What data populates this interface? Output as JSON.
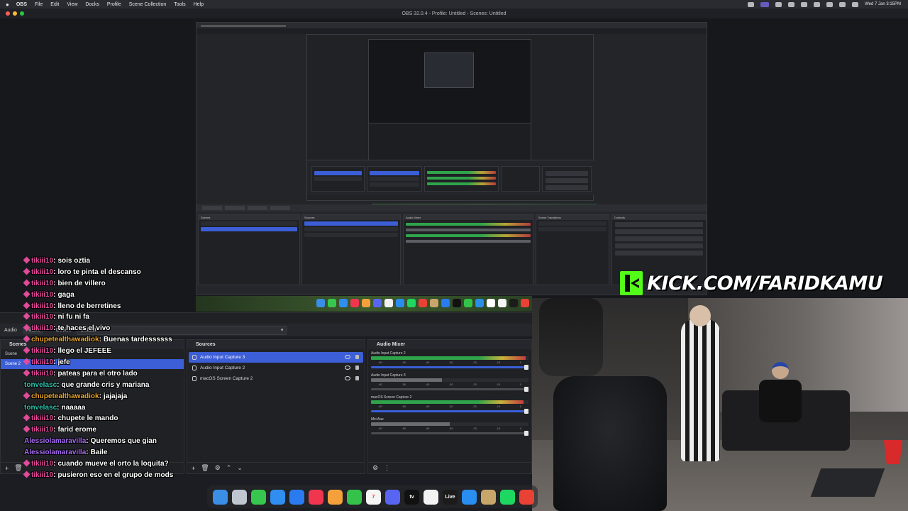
{
  "menubar": {
    "app_name": "OBS",
    "items": [
      "File",
      "Edit",
      "View",
      "Docks",
      "Profile",
      "Scene Collection",
      "Tools",
      "Help"
    ],
    "clock": "Wed 7 Jan  3:15PM"
  },
  "window": {
    "title": "OBS 32.0.4 - Profile: Untitled - Scenes: Untitled"
  },
  "kick_banner": {
    "text": "KICK.COM/FARIDKAMU",
    "color": "#53fc18"
  },
  "properties_bar": {
    "source_label": "Audio",
    "filters_tab": "Filters",
    "device_label": "Device",
    "device_value": "Default"
  },
  "scenes": {
    "title": "Scenes",
    "items": [
      "Scene",
      "Scene 2"
    ],
    "selected_index": 1
  },
  "sources": {
    "title": "Sources",
    "items": [
      {
        "name": "Audio Input Capture 3",
        "icon": "microphone-icon",
        "selected": true
      },
      {
        "name": "Audio Input Capture 2",
        "icon": "microphone-icon",
        "selected": false
      },
      {
        "name": "macOS Screen Capture 2",
        "icon": "monitor-icon",
        "selected": false
      }
    ]
  },
  "audio_mixer": {
    "title": "Audio Mixer",
    "channels": [
      {
        "name": "Audio Input Capture 2",
        "level": 0.98,
        "muted": false
      },
      {
        "name": "Audio Input Capture 3",
        "level": 0.45,
        "muted": true
      },
      {
        "name": "macOS Screen Capture 2",
        "level": 0.97,
        "muted": false
      },
      {
        "name": "Mic/Aux",
        "level": 0.5,
        "muted": true
      }
    ],
    "ticks": [
      "-60",
      "-55",
      "-50",
      "-45",
      "-40",
      "-35",
      "-30",
      "-25",
      "-20",
      "-15",
      "-10",
      "-5",
      "0"
    ]
  },
  "chat": [
    {
      "user": "tikiii10",
      "user_color": "#e24a9a",
      "badge": true,
      "text": "sois oztia"
    },
    {
      "user": "tikiii10",
      "user_color": "#e24a9a",
      "badge": true,
      "text": "loro te pinta el descanso"
    },
    {
      "user": "tikiii10",
      "user_color": "#e24a9a",
      "badge": true,
      "text": "bien de villero"
    },
    {
      "user": "tikiii10",
      "user_color": "#e24a9a",
      "badge": true,
      "text": "gaga"
    },
    {
      "user": "tikiii10",
      "user_color": "#e24a9a",
      "badge": true,
      "text": "lleno de berretines"
    },
    {
      "user": "tikiii10",
      "user_color": "#e24a9a",
      "badge": true,
      "text": "ni fu ni fa"
    },
    {
      "user": "tikiii10",
      "user_color": "#e24a9a",
      "badge": true,
      "text": "te haces el vivo"
    },
    {
      "user": "chupetealthawadiok",
      "user_color": "#e8a531",
      "badge": true,
      "text": "Buenas tardessssss"
    },
    {
      "user": "tikiii10",
      "user_color": "#e24a9a",
      "badge": true,
      "text": "llego el JEFEEE"
    },
    {
      "user": "tikiii10",
      "user_color": "#e24a9a",
      "badge": true,
      "text": "jefe"
    },
    {
      "user": "tikiii10",
      "user_color": "#e24a9a",
      "badge": true,
      "text": "pateas para el otro lado"
    },
    {
      "user": "tonvelasc",
      "user_color": "#31c4b0",
      "badge": false,
      "text": "que grande cris y mariana"
    },
    {
      "user": "chupetealthawadiok",
      "user_color": "#e8a531",
      "badge": true,
      "text": "jajajaja"
    },
    {
      "user": "tonvelasc",
      "user_color": "#31c4b0",
      "badge": false,
      "text": "naaaaa"
    },
    {
      "user": "tikiii10",
      "user_color": "#e24a9a",
      "badge": true,
      "text": "chupete le mando"
    },
    {
      "user": "tikiii10",
      "user_color": "#e24a9a",
      "badge": true,
      "text": "farid erome"
    },
    {
      "user": "Alessiolamaravilla",
      "user_color": "#a56bf0",
      "badge": false,
      "text": "Queremos que gian"
    },
    {
      "user": "Alessiolamaravilla",
      "user_color": "#a56bf0",
      "badge": false,
      "text": "Baile"
    },
    {
      "user": "tikiii10",
      "user_color": "#e24a9a",
      "badge": true,
      "text": "cuando mueve el orto la loquita?"
    },
    {
      "user": "tikiii10",
      "user_color": "#e24a9a",
      "badge": true,
      "text": "pusieron eso en el grupo de mods"
    }
  ],
  "mac_dock": {
    "apps": [
      {
        "name": "finder-icon",
        "color": "#3a8ee6",
        "label": ""
      },
      {
        "name": "launchpad-icon",
        "color": "#c0c6d0",
        "label": ""
      },
      {
        "name": "messages-icon",
        "color": "#37c74f",
        "label": ""
      },
      {
        "name": "mail-icon",
        "color": "#2f8ef0",
        "label": ""
      },
      {
        "name": "appstore-icon",
        "color": "#2a7bf0",
        "label": ""
      },
      {
        "name": "music-icon",
        "color": "#f0364f",
        "label": ""
      },
      {
        "name": "photos-icon",
        "color": "#f4a13b",
        "label": ""
      },
      {
        "name": "facetime-icon",
        "color": "#35c24a",
        "label": ""
      },
      {
        "name": "calendar-icon",
        "color": "#f5f5f5",
        "label": "7"
      },
      {
        "name": "discord-icon",
        "color": "#5865f2",
        "label": ""
      },
      {
        "name": "appletv-icon",
        "color": "#111111",
        "label": "tv"
      },
      {
        "name": "notes-icon",
        "color": "#f2f2f2",
        "label": ""
      },
      {
        "name": "live-icon",
        "color": "#1b1b1b",
        "label": "Live"
      },
      {
        "name": "safari-icon",
        "color": "#2a8df0",
        "label": ""
      },
      {
        "name": "misc-icon",
        "color": "#c8a66a",
        "label": ""
      },
      {
        "name": "spotify-icon",
        "color": "#1ed760",
        "label": ""
      },
      {
        "name": "chrome-icon",
        "color": "#e94235",
        "label": ""
      }
    ]
  }
}
